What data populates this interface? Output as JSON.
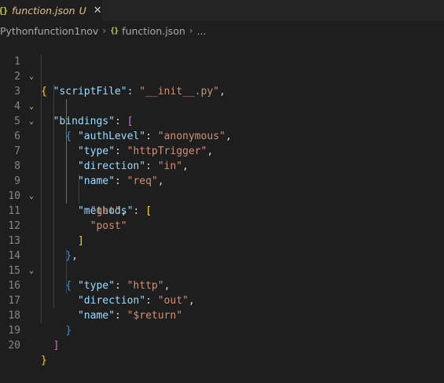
{
  "tab": {
    "icon": "{}",
    "icon_name": "json-file-icon",
    "label": "function.json",
    "status": "U",
    "close": "✕"
  },
  "breadcrumb": {
    "folder": "Pythonfunction1nov",
    "file_icon": "{}",
    "file": "function.json",
    "more": "...",
    "separator": "›"
  },
  "colors": {
    "key": "#9cdcfe",
    "string": "#ce9178",
    "bracket_level1": "#ffd700",
    "bracket_level2": "#da70d6",
    "bracket_level3": "#179fff",
    "modified": "#e2c08d"
  },
  "editor": {
    "lines": [
      {
        "n": "1"
      },
      {
        "n": "2"
      },
      {
        "n": "3"
      },
      {
        "n": "4"
      },
      {
        "n": "5"
      },
      {
        "n": "6"
      },
      {
        "n": "7"
      },
      {
        "n": "8"
      },
      {
        "n": "9"
      },
      {
        "n": "10"
      },
      {
        "n": "11"
      },
      {
        "n": "12"
      },
      {
        "n": "13"
      },
      {
        "n": "14"
      },
      {
        "n": "15"
      },
      {
        "n": "16"
      },
      {
        "n": "17"
      },
      {
        "n": "18"
      },
      {
        "n": "19"
      },
      {
        "n": "20"
      }
    ],
    "tokens": {
      "l1_open": "{",
      "l2_key": "\"scriptFile\"",
      "l2_val": "\"__init__.py\"",
      "l3_key": "\"bindings\"",
      "l3_open": "[",
      "l4_open": "{",
      "l5_key": "\"authLevel\"",
      "l5_val": "\"anonymous\"",
      "l6_key": "\"type\"",
      "l6_val": "\"httpTrigger\"",
      "l7_key": "\"direction\"",
      "l7_val": "\"in\"",
      "l8_key": "\"name\"",
      "l8_val": "\"req\"",
      "l9_key": "\"methods\"",
      "l9_open": "[",
      "l10_val": "\"get\"",
      "l11_val": "\"post\"",
      "l12_close": "]",
      "l13_close": "}",
      "l14_open": "{",
      "l15_key": "\"type\"",
      "l15_val": "\"http\"",
      "l16_key": "\"direction\"",
      "l16_val": "\"out\"",
      "l17_key": "\"name\"",
      "l17_val": "\"$return\"",
      "l18_close": "}",
      "l19_close": "]",
      "l20_close": "}",
      "colon": ": ",
      "comma": ","
    }
  }
}
